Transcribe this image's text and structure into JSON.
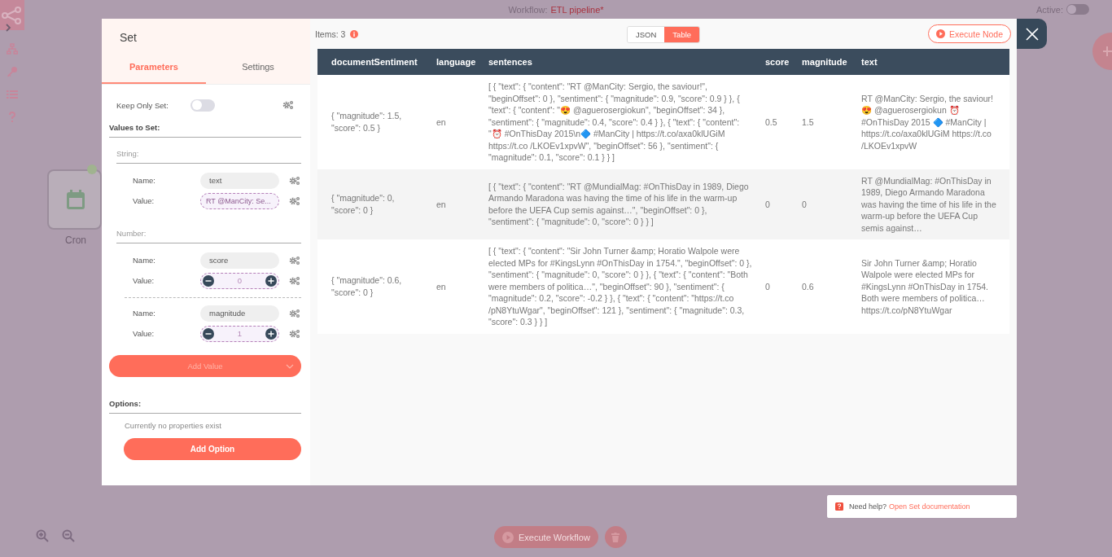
{
  "workflow": {
    "label": "Workflow:",
    "name": "ETL pipeline*",
    "active_label": "Active:",
    "active": false
  },
  "canvas": {
    "nodes": [
      {
        "name": "Cron"
      }
    ],
    "execute_button": "Execute Workflow"
  },
  "node_panel": {
    "title": "Set",
    "tabs": [
      {
        "label": "Parameters",
        "selected": true
      },
      {
        "label": "Settings",
        "selected": false
      }
    ],
    "keep_only_set": {
      "label": "Keep Only Set:",
      "on": false
    },
    "values_heading": "Values to Set:",
    "groups": [
      {
        "label": "String:",
        "items": [
          {
            "kind": "string",
            "name_label": "Name:",
            "name": "text",
            "value_label": "Value:",
            "value": "RT @ManCity: Se..."
          }
        ]
      },
      {
        "label": "Number:",
        "items": [
          {
            "kind": "number",
            "name_label": "Name:",
            "name": "score",
            "value_label": "Value:",
            "value": "0"
          },
          {
            "kind": "number",
            "name_label": "Name:",
            "name": "magnitude",
            "value_label": "Value:",
            "value": "1"
          }
        ]
      }
    ],
    "add_value": "Add Value",
    "options_heading": "Options:",
    "options_empty": "Currently no properties exist",
    "add_option": "Add Option"
  },
  "output": {
    "items_label": "Items: 3",
    "views": [
      {
        "label": "JSON",
        "selected": false
      },
      {
        "label": "Table",
        "selected": true
      }
    ],
    "execute_node": "Execute Node",
    "table": {
      "columns": [
        "documentSentiment",
        "language",
        "sentences",
        "score",
        "magnitude",
        "text"
      ],
      "rows": [
        [
          "{ \"magnitude\": 1.5, \"score\": 0.5 }",
          "en",
          "[ { \"text\": { \"content\": \"RT @ManCity: Sergio, the saviour!\", \"beginOffset\": 0 }, \"sentiment\": { \"magnitude\": 0.9, \"score\": 0.9 } }, { \"text\": { \"content\": \"😍 @aguerosergiokun\", \"beginOffset\": 34 }, \"sentiment\": { \"magnitude\": 0.4, \"score\": 0.4 } }, { \"text\": { \"content\": \"⏰ #OnThisDay 2015\\n🔷 #ManCity | https://t.co/axa0klUGiM https://t.co /LKOEv1xpvW\", \"beginOffset\": 56 }, \"sentiment\": { \"magnitude\": 0.1, \"score\": 0.1 } } ]",
          "0.5",
          "1.5",
          "RT @ManCity: Sergio, the saviour! 😍 @aguerosergiokun ⏰ #OnThisDay 2015 🔷 #ManCity | https://t.co/axa0klUGiM https://t.co /LKOEv1xpvW"
        ],
        [
          "{ \"magnitude\": 0, \"score\": 0 }",
          "en",
          "[ { \"text\": { \"content\": \"RT @MundialMag: #OnThisDay in 1989, Diego Armando Maradona was having the time of his life in the warm-up before the UEFA Cup semis against…\", \"beginOffset\": 0 }, \"sentiment\": { \"magnitude\": 0, \"score\": 0 } } ]",
          "0",
          "0",
          "RT @MundialMag: #OnThisDay in 1989, Diego Armando Maradona was having the time of his life in the warm-up before the UEFA Cup semis against…"
        ],
        [
          "{ \"magnitude\": 0.6, \"score\": 0 }",
          "en",
          "[ { \"text\": { \"content\": \"Sir John Turner &amp; Horatio Walpole were elected MPs for #KingsLynn #OnThisDay in 1754.\", \"beginOffset\": 0 }, \"sentiment\": { \"magnitude\": 0, \"score\": 0 } }, { \"text\": { \"content\": \"Both were members of politica…\", \"beginOffset\": 90 }, \"sentiment\": { \"magnitude\": 0.2, \"score\": -0.2 } }, { \"text\": { \"content\": \"https://t.co /pN8YtuWgar\", \"beginOffset\": 121 }, \"sentiment\": { \"magnitude\": 0.3, \"score\": 0.3 } } ]",
          "0",
          "0.6",
          "Sir John Turner &amp; Horatio Walpole were elected MPs for #KingsLynn #OnThisDay in 1754. Both were members of politica… https://t.co/pN8YtuWgar"
        ]
      ]
    }
  },
  "help": {
    "text": "Need help?",
    "link": "Open Set documentation"
  }
}
